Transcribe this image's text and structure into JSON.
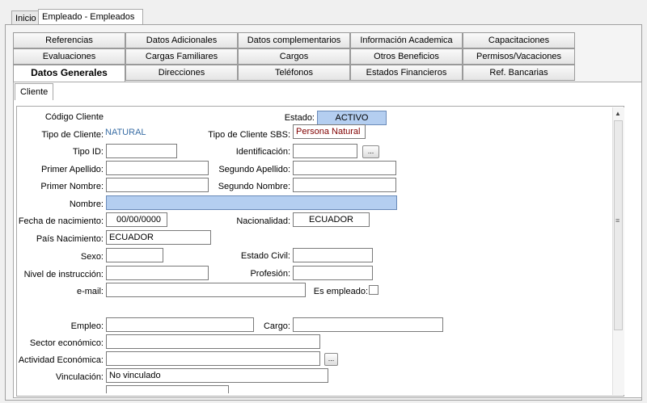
{
  "top_tabs": [
    {
      "label": "Inicio",
      "active": false
    },
    {
      "label": "Empleado - Empleados",
      "active": true
    }
  ],
  "tab_rows": [
    [
      "Referencias",
      "Datos Adicionales",
      "Datos complementarios",
      "Información Academica",
      "Capacitaciones"
    ],
    [
      "Evaluaciones",
      "Cargas Familiares",
      "Cargos",
      "Otros Beneficios",
      "Permisos/Vacaciones"
    ],
    [
      "Datos Generales",
      "Direcciones",
      "Teléfonos",
      "Estados Financieros",
      "Ref. Bancarias"
    ]
  ],
  "subtab": "Cliente",
  "form": {
    "codigo_cliente_label": "Código Cliente",
    "estado_label": "Estado:",
    "estado_value": "ACTIVO",
    "tipo_cliente_label": "Tipo de Cliente:",
    "tipo_cliente_value": "NATURAL",
    "tipo_cliente_sbs_label": "Tipo de Cliente SBS:",
    "tipo_cliente_sbs_value": "Persona Natural",
    "tipo_id_label": "Tipo ID:",
    "identificacion_label": "Identificación:",
    "identificacion_button": "...",
    "primer_apellido_label": "Primer Apellido:",
    "segundo_apellido_label": "Segundo Apellido:",
    "primer_nombre_label": "Primer Nombre:",
    "segundo_nombre_label": "Segundo Nombre:",
    "nombre_label": "Nombre:",
    "fecha_nacimiento_label": "Fecha de nacimiento:",
    "fecha_nacimiento_value": "00/00/0000",
    "nacionalidad_label": "Nacionalidad:",
    "nacionalidad_value": "ECUADOR",
    "pais_nacimiento_label": "País Nacimiento:",
    "pais_nacimiento_value": "ECUADOR",
    "sexo_label": "Sexo:",
    "estado_civil_label": "Estado Civil:",
    "nivel_instruccion_label": "Nivel de instrucción:",
    "profesion_label": "Profesión:",
    "email_label": "e-mail:",
    "es_empleado_label": "Es empleado:",
    "empleo_label": "Empleo:",
    "cargo_label": "Cargo:",
    "sector_economico_label": "Sector económico:",
    "actividad_economica_label": "Actividad Económica:",
    "actividad_button": "...",
    "vinculacion_label": "Vinculación:",
    "vinculacion_value": "No vinculado"
  },
  "colors": {
    "highlight_field": "#b4cef0",
    "tipo_cliente_text": "#3a6ea5",
    "sbs_text": "#800000"
  }
}
